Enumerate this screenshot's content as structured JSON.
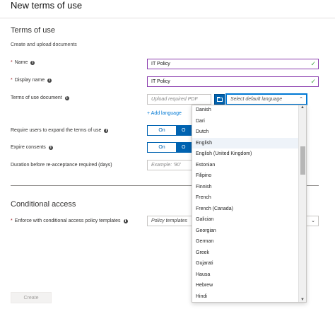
{
  "header": {
    "title": "New terms of use"
  },
  "terms": {
    "section_title": "Terms of use",
    "description": "Create and upload documents",
    "name": {
      "label": "Name",
      "value": "IT Policy"
    },
    "display_name": {
      "label": "Display name",
      "value": "IT Policy"
    },
    "document": {
      "label": "Terms of use document",
      "upload_placeholder": "Upload required PDF",
      "language_placeholder": "Select default language",
      "add_language": "+ Add language"
    },
    "require_expand": {
      "label": "Require users to expand the terms of use",
      "on": "On",
      "off": "O"
    },
    "expire_consents": {
      "label": "Expire consents",
      "on": "On",
      "off": "O"
    },
    "duration": {
      "label": "Duration before re-acceptance required (days)",
      "placeholder": "Example: '90'"
    }
  },
  "conditional": {
    "section_title": "Conditional access",
    "enforce": {
      "label": "Enforce with conditional access policy templates",
      "value": "Policy templates"
    }
  },
  "footer": {
    "create_label": "Create"
  },
  "language_dropdown": {
    "selected": "English",
    "items": [
      "Danish",
      "Dari",
      "Dutch",
      "English",
      "English (United Kingdom)",
      "Estonian",
      "Filipino",
      "Finnish",
      "French",
      "French (Canada)",
      "Galician",
      "Georgian",
      "German",
      "Greek",
      "Gujarati",
      "Hausa",
      "Hebrew",
      "Hindi"
    ]
  }
}
